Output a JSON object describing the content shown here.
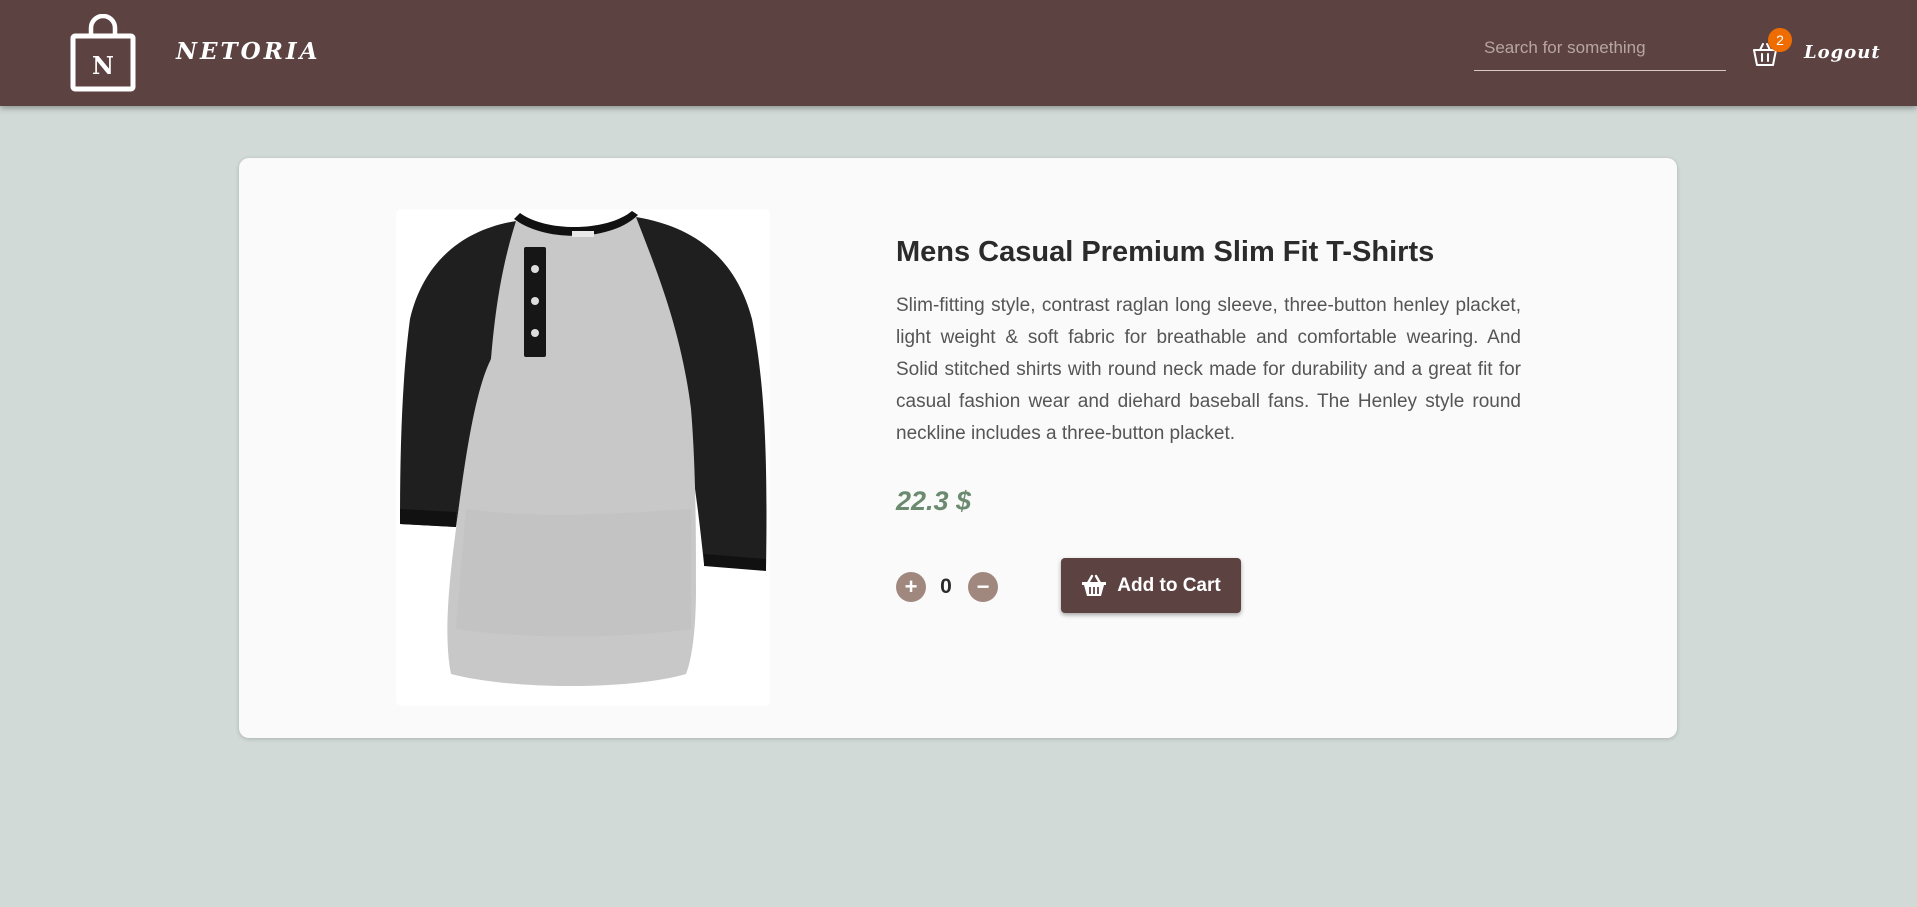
{
  "header": {
    "logo_letter": "N",
    "brand": "NETORIA",
    "search_placeholder": "Search for something",
    "cart_count": "2",
    "logout_label": "Logout"
  },
  "product": {
    "title": "Mens Casual Premium Slim Fit T-Shirts",
    "description": "Slim-fitting style, contrast raglan long sleeve, three-button henley placket, light weight & soft fabric for breathable and comfortable wearing. And Solid stitched shirts with round neck made for durability and a great fit for casual fashion wear and diehard baseball fans. The Henley style round neckline includes a three-button placket.",
    "price": "22.3 $",
    "quantity": "0",
    "plus_label": "+",
    "minus_label": "−",
    "add_to_cart_label": "Add to Cart"
  },
  "colors": {
    "header_bg": "#5c4342",
    "page_bg": "#d1dad6",
    "accent_badge": "#ef6c00",
    "price": "#6b8a6f"
  },
  "icons": [
    "shopping-bag-logo",
    "cart-icon",
    "basket-icon"
  ]
}
